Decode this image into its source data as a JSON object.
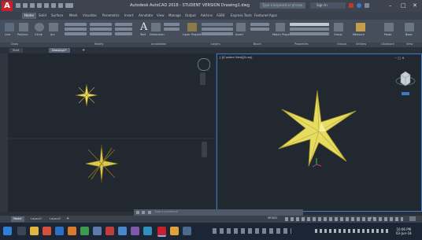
{
  "app": {
    "logo_letter": "A",
    "title": "Autodesk AutoCAD 2018 - STUDENT VERSION   Drawing1.dwg",
    "search_placeholder": "Type a keyword or phrase",
    "sign_in": "Sign In"
  },
  "window_controls": {
    "minimize": "–",
    "maximize": "□",
    "close": "✕"
  },
  "ribbon_tabs": [
    "Home",
    "Solid",
    "Surface",
    "Mesh",
    "Visualize",
    "Parametric",
    "Insert",
    "Annotate",
    "View",
    "Manage",
    "Output",
    "Add-ins",
    "A360",
    "Express Tools",
    "Featured Apps"
  ],
  "ribbon_tab_active": "Home",
  "ribbon_buttons": [
    "Line",
    "Polyline",
    "Circle",
    "Arc",
    "Text",
    "Dimension",
    "Layer Properties",
    "Insert",
    "Match Properties",
    "Group",
    "Measure",
    "Paste",
    "Base"
  ],
  "ribbon_groups": [
    "Draw",
    "Modify",
    "Annotation",
    "Layers",
    "Block",
    "Properties",
    "Groups",
    "Utilities",
    "Clipboard",
    "View"
  ],
  "file_tabs": [
    "Start",
    "Drawing1*"
  ],
  "file_tab_active": "Drawing1*",
  "viewports": {
    "right_label": "[-][Custom View][X-ray]"
  },
  "command_line": {
    "placeholder": "Type a command"
  },
  "layout_tabs": [
    "Model",
    "Layout1",
    "Layout2"
  ],
  "layout_tab_active": "Model",
  "status": {
    "mode": "MODEL",
    "scale": "1:1"
  },
  "taskbar": {
    "time": "10:06 PM",
    "date": "03-Jun-18"
  },
  "colors": {
    "accent": "#3e79c4",
    "logo_red": "#c8202a",
    "star_yellow": "#e6dc60"
  }
}
